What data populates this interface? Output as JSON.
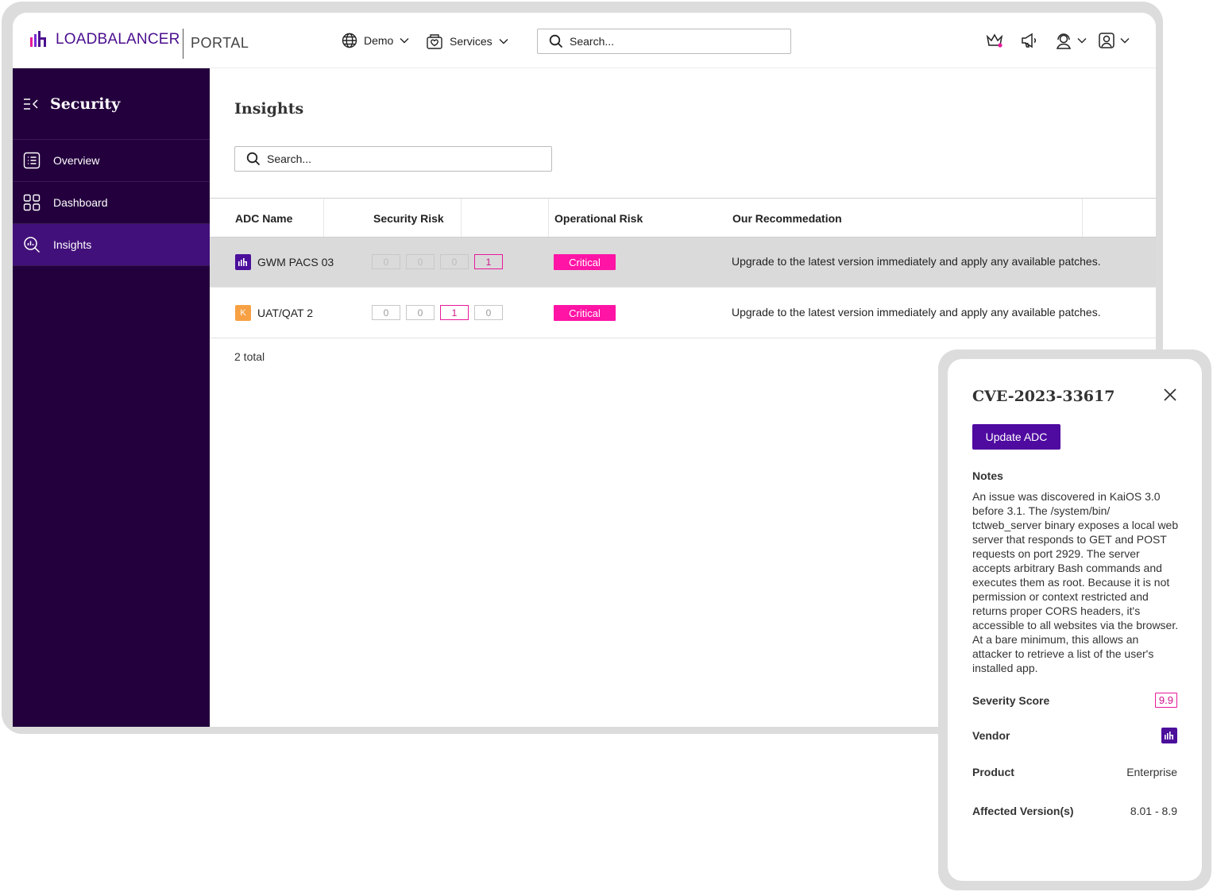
{
  "brand": {
    "name": "LOADBALANCER",
    "portal": "PORTAL",
    "accent": "#4b0f8f"
  },
  "topbar": {
    "demo_label": "Demo",
    "services_label": "Services",
    "search_placeholder": "Search..."
  },
  "sidebar": {
    "title": "Security",
    "items": [
      {
        "label": "Overview",
        "icon": "list-icon"
      },
      {
        "label": "Dashboard",
        "icon": "grid-icon"
      },
      {
        "label": "Insights",
        "icon": "insights-search-icon",
        "active": true
      }
    ]
  },
  "main": {
    "title": "Insights",
    "search_placeholder": "Search...",
    "columns": [
      "ADC Name",
      "Security Risk",
      "Operational Risk",
      "Our Recommedation"
    ],
    "rows": [
      {
        "name": "GWM PACS 03",
        "vendor_badge": "",
        "security_risk": [
          "0",
          "0",
          "0",
          "1"
        ],
        "operational_risk": "Critical",
        "recommendation": "Upgrade to the latest version immediately and apply any available patches."
      },
      {
        "name": "UAT/QAT 2",
        "vendor_badge": "K",
        "security_risk": [
          "0",
          "0",
          "1",
          "0"
        ],
        "operational_risk": "Critical",
        "recommendation": "Upgrade to the latest version immediately and apply any available patches."
      }
    ],
    "total": "2 total"
  },
  "panel": {
    "title": "CVE-2023-33617",
    "update_button": "Update ADC",
    "notes_heading": "Notes",
    "notes": "An issue was discovered in KaiOS 3.0 before 3.1. The /system/bin/ tctweb_server binary exposes a local web server that responds to GET and POST requests on port 2929. The server accepts arbitrary Bash commands and executes them as root. Because it is not permission or context restricted and returns proper CORS headers, it's accessible to all websites via the browser. At a bare minimum, this allows an attacker to retrieve a list of the user's installed app.",
    "severity_label": "Severity Score",
    "severity_value": "9.9",
    "vendor_label": "Vendor",
    "product_label": "Product",
    "product_value": "Enterprise",
    "affected_label": "Affected Version(s)",
    "affected_value": "8.01 - 8.9"
  },
  "colors": {
    "sidebar_bg": "#23003d",
    "sidebar_active": "#42107a",
    "critical": "#ff14a5",
    "primary_button": "#4f0aa0",
    "kemp_orange": "#f7a044"
  }
}
